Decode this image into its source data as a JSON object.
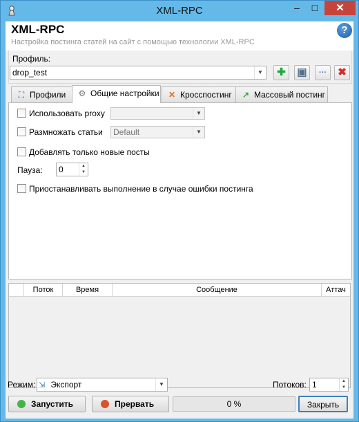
{
  "window": {
    "title": "XML-RPC",
    "minimize_glyph": "–",
    "maximize_glyph": "☐",
    "close_glyph": "✕"
  },
  "header": {
    "title": "XML-RPC",
    "subtitle": "Настройка постинга статей на сайт с помощью технологии XML-RPC",
    "help_glyph": "?"
  },
  "profile": {
    "label": "Профиль:",
    "selected": "drop_test"
  },
  "toolbar": {
    "add_glyph": "✚",
    "save_glyph": "▣",
    "options_glyph": "···",
    "delete_glyph": "✖",
    "colors": {
      "add": "#1fa83a",
      "save": "#56708c",
      "options": "#2f73c8",
      "delete": "#d42b2b"
    }
  },
  "tabs": [
    {
      "label": "Профили",
      "icon": "network-icon",
      "active": false
    },
    {
      "label": "Общие настройки",
      "icon": "gear-icon",
      "active": true
    },
    {
      "label": "Кросспостинг",
      "icon": "crosspost-icon",
      "active": false
    },
    {
      "label": "Массовый постинг",
      "icon": "arrow-icon",
      "active": false
    }
  ],
  "settings": {
    "use_proxy": {
      "label": "Использовать proxy",
      "checked": false,
      "select_value": ""
    },
    "multiply": {
      "label": "Размножать статьи",
      "checked": false,
      "select_value": "Default"
    },
    "only_new": {
      "label": "Добавлять только новые посты",
      "checked": false
    },
    "pause": {
      "label": "Пауза:",
      "value": "0"
    },
    "stop_on_error": {
      "label": "Приостанавливать выполнение в случае ошибки постинга",
      "checked": false
    }
  },
  "log": {
    "columns": [
      "Поток",
      "Время",
      "Сообщение",
      "Аттач"
    ]
  },
  "mode": {
    "label": "Режим:",
    "value": "Экспорт"
  },
  "threads": {
    "label": "Потоков:",
    "value": "1"
  },
  "actions": {
    "start": "Запустить",
    "abort": "Прервать",
    "close": "Закрыть"
  },
  "progress": {
    "percent": 0,
    "text": "0 %"
  },
  "colors": {
    "titlebar": "#65b9e8",
    "close_button": "#c7443d",
    "progress_fill": "#06b025"
  }
}
